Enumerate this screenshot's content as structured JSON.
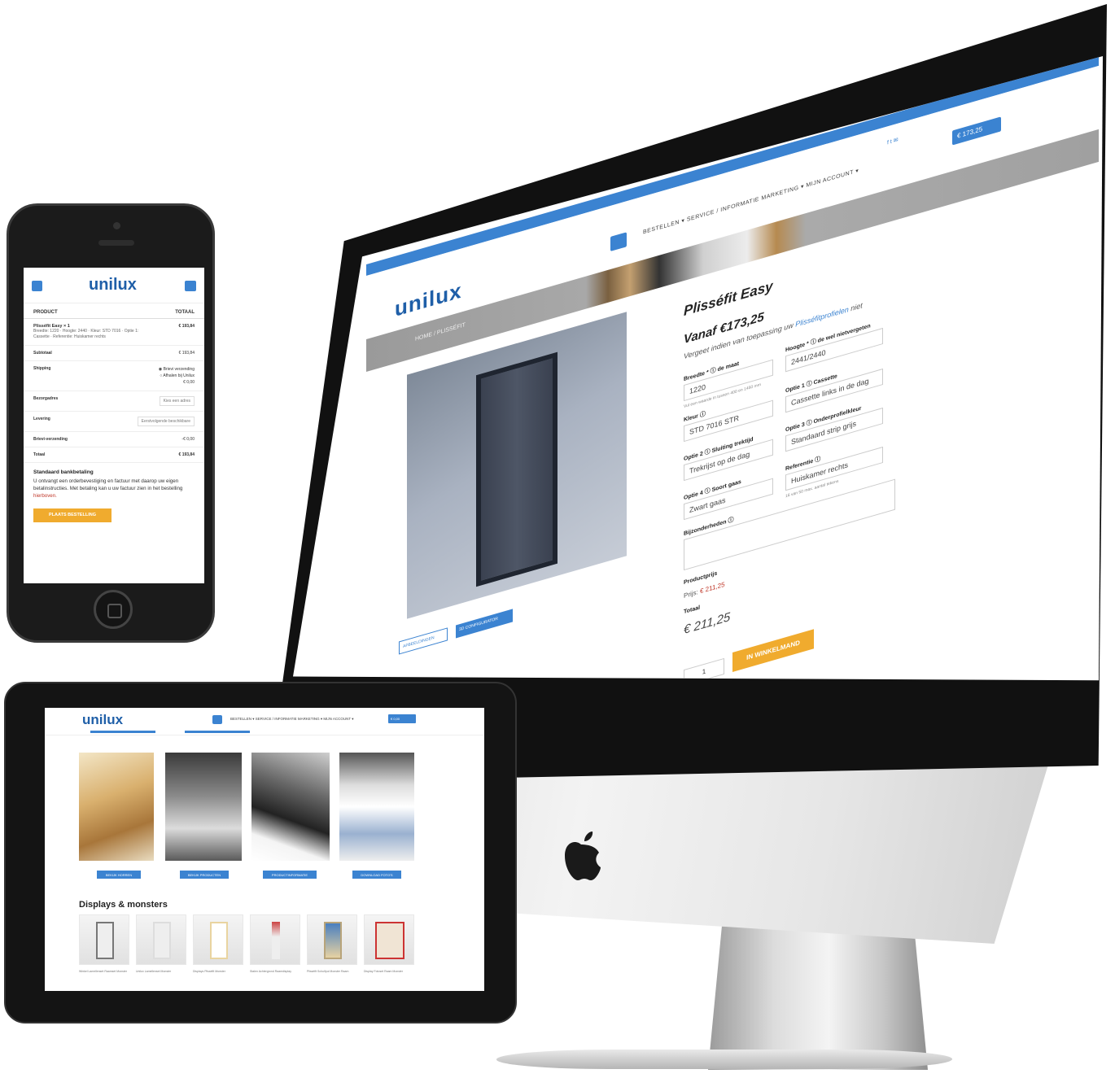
{
  "desktop": {
    "logo": "unilux",
    "nav": "BESTELLEN ▾   SERVICE / INFORMATIE   MARKETING ▾   MIJN ACCOUNT ▾",
    "cart_total": "€ 173,25",
    "breadcrumb": "HOME  /  PLISSÉFIT",
    "product_title": "Plisséfit Easy",
    "price_from": "Vanaf €173,25",
    "note_prefix": "Vergeet indien van toepassing uw ",
    "note_link": "Plisséfitprofielen",
    "note_suffix": " niet",
    "fields": {
      "breedte_label": "Breedte * ⓘ de maat",
      "breedte_value": "1220",
      "breedte_hint": "Vul een waarde in tussen 400 en 1450 mm",
      "hoogte_label": "Hoogte * ⓘ de wel nietvergeten",
      "hoogte_value": "2441/2440",
      "kleur_label": "Kleur ⓘ",
      "kleur_value": "STD 7016 STR",
      "optie1_label": "Optie 1 ⓘ Cassette",
      "optie1_value": "Cassette links in de dag",
      "optie2_label": "Optie 2 ⓘ Sluiting trektijd",
      "optie2_value": "Trekrijst op de dag",
      "optie3_label": "Optie 3 ⓘ Onderprofielkleur",
      "optie3_value": "Standaard strip grijs",
      "optie4_label": "Optie 4 ⓘ Soort gaas",
      "optie4_value": "Zwart gaas",
      "referentie_label": "Referentie ⓘ",
      "referentie_value": "Huiskamer rechts",
      "referentie_hint": "16 van 50 max. aantal tekens",
      "bijzonderheden_label": "Bijzonderheden ⓘ"
    },
    "buttons": {
      "afbeeldingen": "AFBEELDINGEN",
      "configurator": "3D CONFIGURATOR",
      "add_to_cart": "IN WINKELMAND"
    },
    "productprijs_label": "Productprijs",
    "productprijs_prefix": "Prijs: ",
    "productprijs_value": "€ 211,25",
    "totaal_label": "Totaal",
    "totaal_value": "€ 211,25",
    "quantity": "1"
  },
  "phone": {
    "logo": "unilux",
    "col_product": "PRODUCT",
    "col_totaal": "TOTAAL",
    "product_name": "Plisséfit Easy  × 1",
    "product_details": "Breedte: 1220 · Hoogte: 2440 · Kleur: STD 7016 · Optie 1: Cassette · Referentie: Huiskamer rechts",
    "product_price": "€ 193,84",
    "subtotaal_label": "Subtotaal",
    "subtotaal_value": "€ 193,84",
    "shipping_label": "Shipping",
    "shipping_opt1": "Brievi verzending",
    "shipping_opt2": "Afhalen bij Unilux",
    "shipping_price": "€ 0,00",
    "adres_label": "Bezorgadres",
    "adres_value": "Kies een adres",
    "levering_label": "Levering",
    "levering_value": "Eerstvolgende beschikbare",
    "korting_label": "Brievi-verzending",
    "korting_value": "-€ 0,00",
    "totaal_label": "Totaal",
    "totaal_value": "€ 193,84",
    "bank_heading": "Standaard bankbetaling",
    "bank_text": "U ontvangt een orderbevestiging en factuur met daarop uw eigen betalinstructies. Met betaling kan u uw factuur zien in het bestelling ",
    "bank_link": "hierboven.",
    "order_button": "PLAATS BESTELLING"
  },
  "tablet": {
    "logo": "unilux",
    "nav": "BESTELLEN ▾   SERVICE / INFORMATIE   MARKETING ▾   MIJN ACCOUNT ▾",
    "cart": "€ 0,00",
    "buttons": [
      "BEKIJK HORREN",
      "BEKIJK PRODUCTEN",
      "PRODUCTINFORMATIE",
      "DOWNLOAD FOTO'S"
    ],
    "section_title": "Displays & monsters",
    "products": [
      "Winkel Lamellenset Raamset Monster",
      "Unilux Lamellenset Monster",
      "Displays Plisséfit Monster",
      "Stalen Achtergrond Raamdisplay",
      "Plisséfit Schuifpui Monster Raam",
      "Display Fotoset Raam Monster"
    ]
  },
  "colors": {
    "brand_blue": "#3b83d1",
    "brand_orange": "#f0ab2e",
    "logo_blue": "#1f5fa8"
  },
  "icons": [
    "search-icon",
    "cart-icon",
    "menu-icon",
    "apple-logo-icon",
    "home-button-icon",
    "facebook-icon",
    "twitter-icon",
    "mail-icon"
  ]
}
